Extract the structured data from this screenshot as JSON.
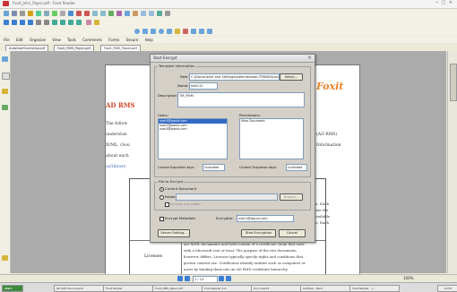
{
  "window": {
    "title": "Foxit_John_Paper.pdf - Foxit Reader",
    "controls": "─ □ ×"
  },
  "menu": [
    "File",
    "Edit",
    "Organize",
    "View",
    "Tools",
    "Comments",
    "Forms",
    "Secure",
    "Help"
  ],
  "tabs": [
    {
      "label": "AutoUserOverview.pdf"
    },
    {
      "label": "Foxit_RMS_Paper.pdf"
    },
    {
      "label": "Foxit_RMS_Paper.pdf",
      "active": true
    }
  ],
  "document": {
    "heading": "AD RMS",
    "logo": "Foxit",
    "paragraph_left": [
      "The follow",
      "understan",
      "XrML. (Sou",
      "about each"
    ],
    "link_left": "us/library",
    "paragraph_right": [
      "(AD RMS)",
      "Information"
    ],
    "table_header_left": "Sc",
    "table_right_lines": [
      "es. Each",
      "cate the",
      "available",
      "es. Each"
    ],
    "table_body_lines": [
      "are XrML documents and both contain of a certificate chain that ends",
      "with a Microsoft root of trust. The purpose of the two documents,",
      "however, differs. Licenses typically specify rights and conditions that",
      "govern content use. Certificates identify entities such as computers or",
      "users by binding them into an AD RMS certificate hierarchy."
    ],
    "table_label": "Licenses"
  },
  "dialog": {
    "title": "Start Encrypt",
    "close": "×",
    "template_group": "Template Information",
    "path_label": "Path:",
    "path_value": "C:\\Documents and Settings\\administrator.ITPANDI\\Local Setti",
    "select_button": "Select...",
    "name_label": "Name:",
    "name_value": "test111",
    "description_label": "Description:",
    "description_value": "TM_FIRM",
    "users_label": "Users:",
    "users": [
      "user1@panid.com",
      "user2@panid.com",
      "user3@panid.com"
    ],
    "permissions_label": "Permissions:",
    "permissions": [
      "View Document"
    ],
    "license_exp_label": "License Expiration days:",
    "license_exp_value": "Unlimited",
    "content_exp_label": "Content Expiration days:",
    "content_exp_value": "Unlimited",
    "file_group": "File to Encrypt",
    "current_doc_label": "Current Document",
    "folder_label": "Folder",
    "browse_button": "Browse...",
    "include_sub_label": "Include sub folder",
    "encrypt_metadata_label": "Encrypt Metadata",
    "encryptor_label": "Encryptor:",
    "encryptor_value": "user1@panid.com",
    "server_setting_button": "Server Setting...",
    "start_button": "Start Encryption",
    "cancel_button": "Cancel"
  },
  "status": {
    "page": "1 / 13",
    "zoom": "100%"
  },
  "taskbar": {
    "start": "start",
    "items": [
      "AD RMS Documents",
      "Foxit Reader",
      "Foxit_RMS_Paper.pdf",
      "Foxit Reader 4.0",
      "Document1",
      "Untitled - Paint",
      "Foxit Reader - [..."
    ],
    "clock": "12:55"
  }
}
